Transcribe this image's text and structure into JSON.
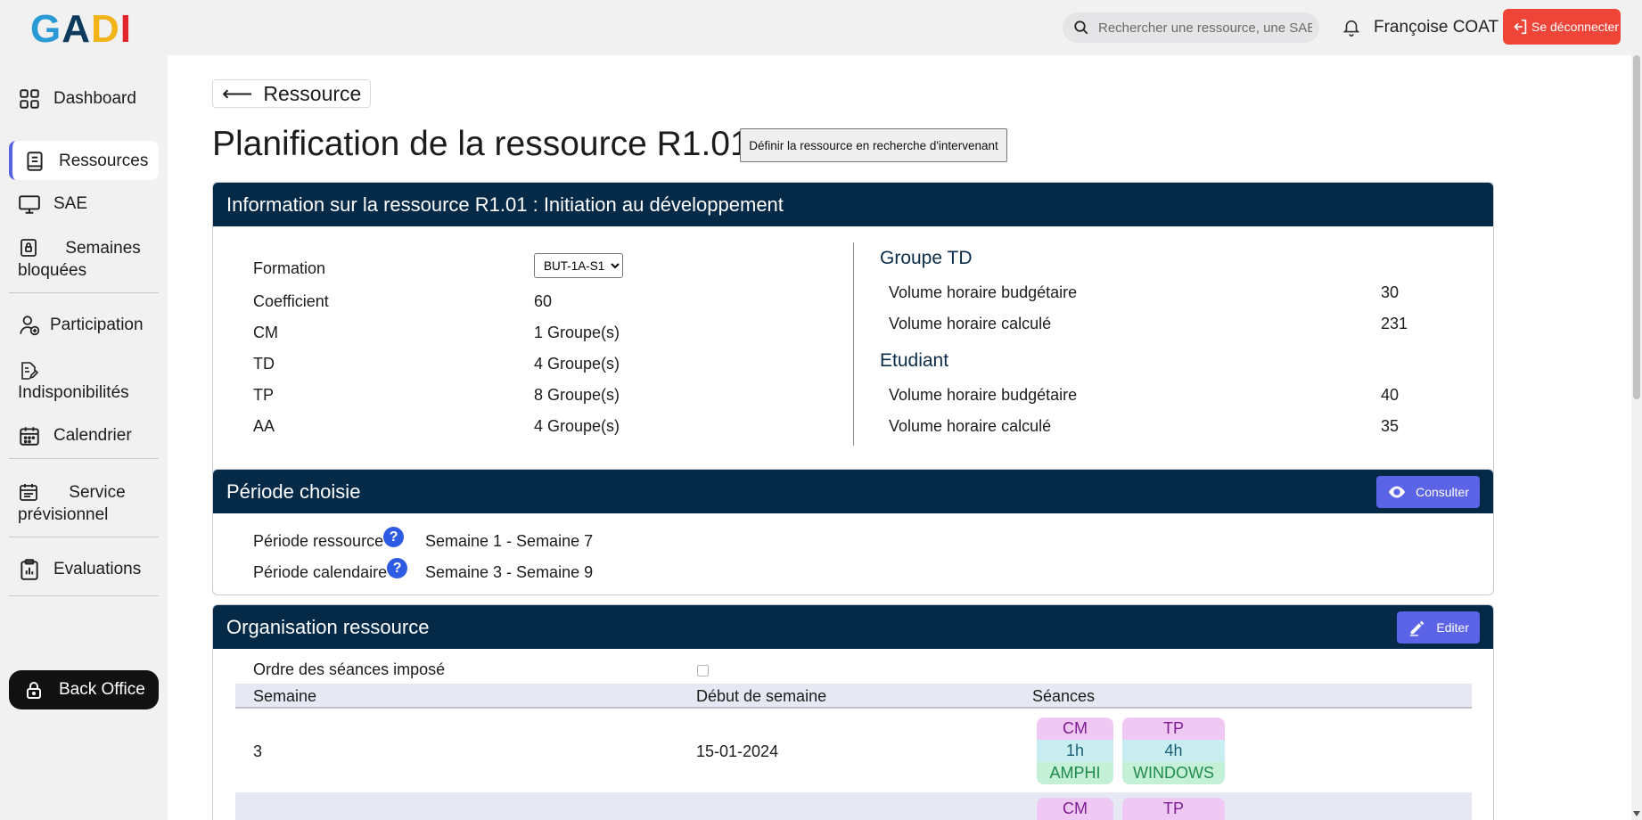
{
  "app": {
    "logo": [
      "G",
      "A",
      "D",
      "I"
    ]
  },
  "topbar": {
    "search_placeholder": "Rechercher une ressource, une SAE ...",
    "username": "Françoise COAT",
    "logout_label": "Se déconnecter"
  },
  "sidebar": {
    "items": [
      {
        "label": "Dashboard",
        "icon": "grid-icon"
      },
      {
        "label": "Ressources",
        "icon": "book-icon"
      },
      {
        "label": "SAE",
        "icon": "monitor-icon"
      },
      {
        "label": "Semaines bloquées",
        "icon": "lock-doc-icon"
      },
      {
        "label": "Participation",
        "icon": "user-add-icon"
      },
      {
        "label": "Indisponibilités",
        "icon": "doc-edit-icon"
      },
      {
        "label": "Calendrier",
        "icon": "calendar-icon"
      },
      {
        "label": "Service prévisionnel",
        "icon": "calendar-list-icon"
      },
      {
        "label": "Evaluations",
        "icon": "clipboard-icon"
      }
    ],
    "back_office_label": "Back Office"
  },
  "page": {
    "back_label": "Ressource",
    "title": "Planification de la ressource R1.01",
    "define_button": "Définir la ressource en recherche d'intervenant"
  },
  "info_card": {
    "title": "Information sur la ressource R1.01 : Initiation au développement",
    "rows": [
      {
        "label": "Formation",
        "value": "BUT-1A-S1"
      },
      {
        "label": "Coefficient",
        "value": "60"
      },
      {
        "label": "CM",
        "value": "1 Groupe(s)"
      },
      {
        "label": "TD",
        "value": "4 Groupe(s)"
      },
      {
        "label": "TP",
        "value": "8 Groupe(s)"
      },
      {
        "label": "AA",
        "value": "4 Groupe(s)"
      }
    ],
    "groupe_td": {
      "title": "Groupe TD",
      "budget_label": "Volume horaire budgétaire",
      "budget_value": "30",
      "calc_label": "Volume horaire calculé",
      "calc_value": "231"
    },
    "etudiant": {
      "title": "Etudiant",
      "budget_label": "Volume horaire budgétaire",
      "budget_value": "40",
      "calc_label": "Volume horaire calculé",
      "calc_value": "35"
    }
  },
  "periode_card": {
    "title": "Période choisie",
    "button_label": "Consulter",
    "ressource_label": "Période ressource",
    "ressource_value": "Semaine 1 - Semaine 7",
    "calendaire_label": "Période calendaire",
    "calendaire_value": "Semaine 3 - Semaine 9",
    "help_glyph": "?"
  },
  "organisation_card": {
    "title": "Organisation ressource",
    "button_label": "Editer",
    "ordre_label": "Ordre des séances imposé",
    "ordre_checked": false,
    "columns": [
      "Semaine",
      "Début de semaine",
      "Séances"
    ],
    "rows": [
      {
        "semaine": "3",
        "debut": "15-01-2024",
        "seances": [
          {
            "type": "CM",
            "duree": "1h",
            "salle": "AMPHI"
          },
          {
            "type": "TP",
            "duree": "4h",
            "salle": "WINDOWS"
          }
        ]
      },
      {
        "semaine": "",
        "debut": "",
        "seances": [
          {
            "type": "CM",
            "duree": "",
            "salle": ""
          },
          {
            "type": "TP",
            "duree": "",
            "salle": ""
          }
        ]
      }
    ]
  }
}
